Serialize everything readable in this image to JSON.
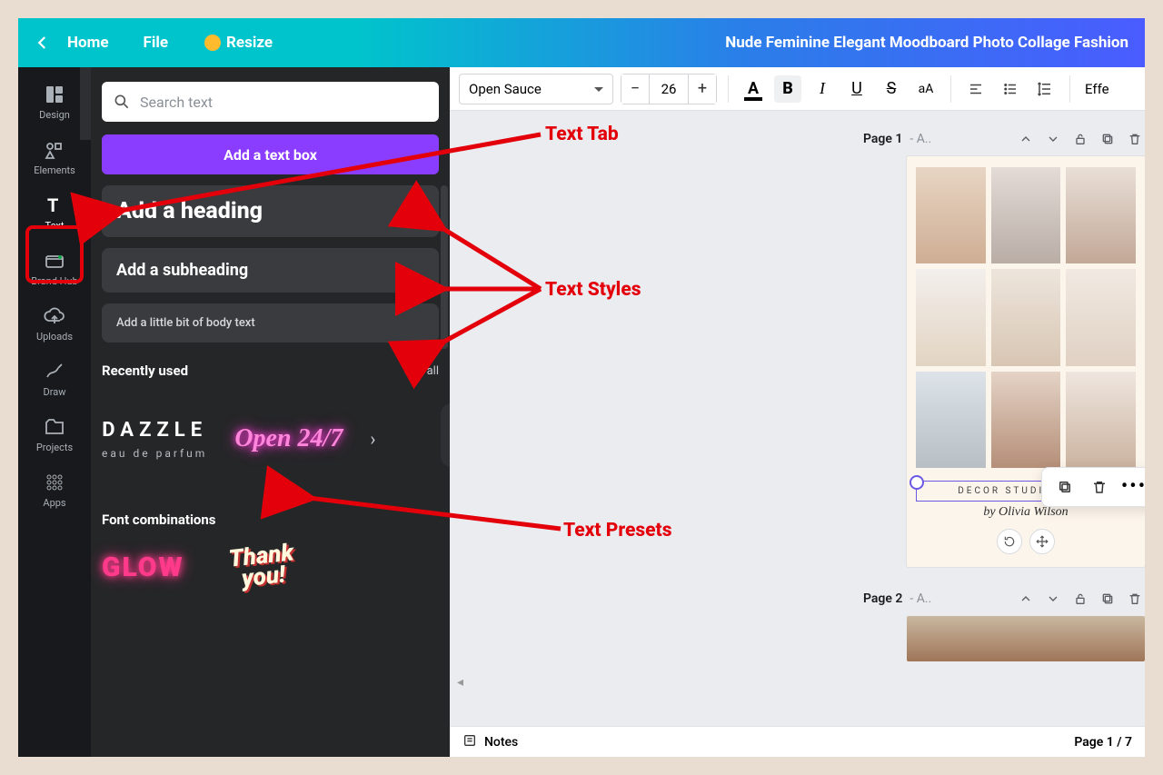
{
  "topbar": {
    "home": "Home",
    "file": "File",
    "resize": "Resize",
    "doc_title": "Nude Feminine Elegant Moodboard Photo Collage Fashion"
  },
  "rail": {
    "design": "Design",
    "elements": "Elements",
    "text": "Text",
    "brandhub": "Brand Hub",
    "uploads": "Uploads",
    "draw": "Draw",
    "projects": "Projects",
    "apps": "Apps"
  },
  "panel": {
    "search_placeholder": "Search text",
    "add_text": "Add a text box",
    "heading": "Add a heading",
    "subheading": "Add a subheading",
    "body": "Add a little bit of body text",
    "recent": "Recently used",
    "see_all": "See all",
    "dazzle_main": "DAZZLE",
    "dazzle_sub": "eau de parfum",
    "open247": "Open 24/7",
    "font_combos": "Font combinations",
    "glow": "GLOW",
    "thanks_l1": "Thank",
    "thanks_l2": "you!"
  },
  "toolbar": {
    "font": "Open Sauce",
    "size": "26",
    "effects": "Effe",
    "A": "A",
    "B": "B",
    "I": "I",
    "U": "U",
    "S": "S",
    "aA": "aA"
  },
  "pages": {
    "p1_label": "Page 1",
    "p1_sub": "- A..",
    "p2_label": "Page 2",
    "p2_sub": "- A..",
    "caption": "DECOR STUDIO & CO.",
    "script": "by Olivia Wilson"
  },
  "bottom": {
    "notes": "Notes",
    "pagecount": "Page 1 / 7"
  },
  "annotations": {
    "text_tab": "Text Tab",
    "text_styles": "Text Styles",
    "text_presets": "Text Presets"
  }
}
